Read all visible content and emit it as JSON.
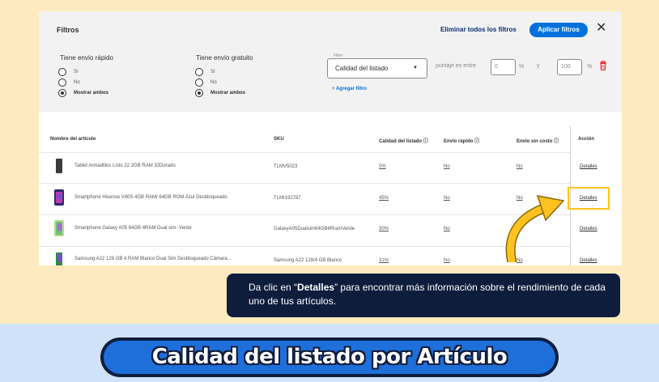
{
  "filters": {
    "title": "Filtros",
    "clear_all": "Eliminar todos los filtros",
    "apply": "Aplicar filtros",
    "fast_shipping": {
      "title": "Tiene envío rápido",
      "options": [
        "Sí",
        "No",
        "Mostrar ambos"
      ],
      "selected": "Mostrar ambos"
    },
    "free_shipping": {
      "title": "Tiene envío gratuito",
      "options": [
        "Sí",
        "No",
        "Mostrar ambos"
      ],
      "selected": "Mostrar ambos"
    },
    "filter_select": {
      "legend": "Filter",
      "value": "Calidad del listado"
    },
    "score_between_label": "puntaje es entre",
    "min_value": "0",
    "and_label": "y",
    "max_value": "100",
    "percent": "%",
    "add_filter": "+ Agregar filtro"
  },
  "table": {
    "headers": [
      "Nombre del artículo",
      "SKU",
      "Calidad del listado",
      "Envío rápido",
      "Envío sin costo",
      "Acción"
    ],
    "rows": [
      {
        "name": "Tablet Armadillos Listo 22 2GB RAM 32Dorado",
        "sku": "TLMV5023",
        "quality": "0%",
        "fast": "No",
        "free": "No",
        "action": "Detalles"
      },
      {
        "name": "Smartphone Hisense V40S 4GB RAM/ 64GB ROM Azul Desbloqueado",
        "sku": "TLMI192787",
        "quality": "45%",
        "fast": "No",
        "free": "No",
        "action": "Detalles"
      },
      {
        "name": "Smartphone Galaxy A05 64GB 4RAM Dual sim- Verde",
        "sku": "GalaxyA05Dualsim64GB4RramVerde",
        "quality": "30%",
        "fast": "No",
        "free": "",
        "action": "Detalles"
      },
      {
        "name": "Samsung A22 128 GB 4 RAM Blanco Dual Sim Desbloqueado Cámara...",
        "sku": "Samsung A22 128/4 GB Blanco",
        "quality": "31%",
        "fast": "No",
        "free": "No",
        "action": "Detalles"
      }
    ]
  },
  "tooltip": {
    "before": "Da clic en “",
    "bold": "Detalles",
    "after": "” para encontrar más información sobre el rendimiento de cada uno de tus artículos."
  },
  "banner": {
    "text": "Calidad del listado por Artículo"
  },
  "colors": {
    "background_top": "#fdeabe",
    "background_bottom": "#cfe2f8",
    "navy": "#0f1d3d",
    "blue": "#1e6fd9",
    "walmart_blue": "#0071dc",
    "highlight_yellow": "#ffc220",
    "trash_red": "#de1c24"
  },
  "icons": {
    "close": "close-icon",
    "dropdown": "chevron-down-icon",
    "trash": "trash-icon",
    "info": "info-icon",
    "arrow": "curved-arrow-icon"
  }
}
